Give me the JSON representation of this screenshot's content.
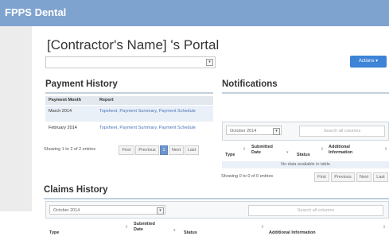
{
  "app": {
    "brand": "FPPS Dental"
  },
  "portal": {
    "title": "[Contractor's Name] 's Portal",
    "contractor_select_value": "",
    "actions_label": "Actions ▾"
  },
  "payment_history": {
    "title": "Payment History",
    "columns": [
      "Payment Month",
      "Report"
    ],
    "rows": [
      {
        "month": "March 2014",
        "report": "Topsheet, Payment Summary, Payment Schedule"
      },
      {
        "month": "February 2014",
        "report": "Topsheet, Payment Summary, Payment Schedule"
      }
    ],
    "info": "Showing 1 to 2 of 2 entries",
    "pager": {
      "first": "First",
      "previous": "Previous",
      "current": "1",
      "next": "Next",
      "last": "Last"
    }
  },
  "notifications": {
    "title": "Notifications",
    "filter_value": "October 2014",
    "search_placeholder": "Search all columns",
    "columns": [
      "Type",
      "Submitted Date",
      "Status",
      "Additional Information"
    ],
    "empty_text": "No data available in table",
    "info": "Showing 0 to 0 of 0 entries",
    "pager": {
      "first": "First",
      "previous": "Previous",
      "next": "Next",
      "last": "Last"
    }
  },
  "claims_history": {
    "title": "Claims History",
    "filter_value": "October 2014",
    "search_placeholder": "Search all columns",
    "columns": [
      "Type",
      "Submitted Date",
      "Status",
      "Additional Information"
    ]
  },
  "colors": {
    "topbar": "#7fa3cf",
    "accent": "#3d83d6",
    "link": "#4a73b8",
    "active_page": "#6d95cc"
  },
  "icons": {
    "select_arrow": "dropdown-arrow-icon",
    "sort": "sort-icon"
  }
}
